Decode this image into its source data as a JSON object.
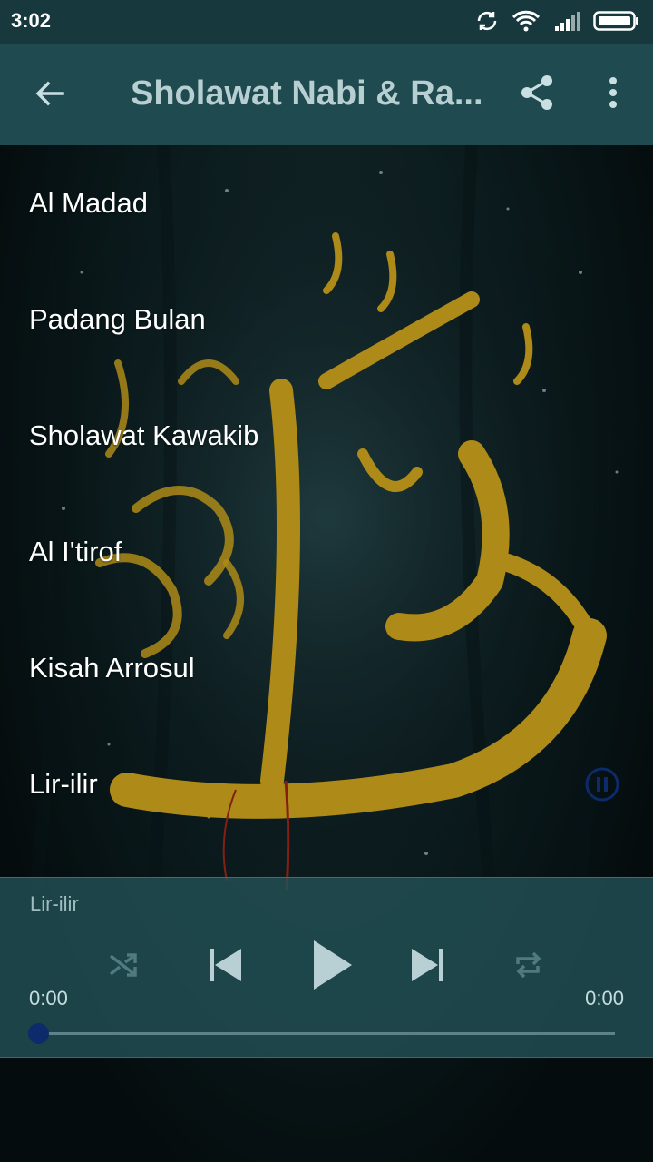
{
  "status_bar": {
    "time": "3:02",
    "icons": [
      "sync-icon",
      "wifi-icon",
      "signal-icon",
      "battery-icon"
    ]
  },
  "app_bar": {
    "title": "Sholawat Nabi & Ra...",
    "back_icon": "arrow-left-icon",
    "share_icon": "share-icon",
    "menu_icon": "more-vert-icon"
  },
  "songs": [
    {
      "title": "Al Madad"
    },
    {
      "title": "Padang Bulan"
    },
    {
      "title": "Sholawat Kawakib"
    },
    {
      "title": "Al I'tirof"
    },
    {
      "title": "Kisah Arrosul"
    },
    {
      "title": "Lir-ilir"
    }
  ],
  "player": {
    "now_playing": "Lir-ilir",
    "time_current": "0:00",
    "time_total": "0:00",
    "progress": 0,
    "controls": [
      "shuffle-icon",
      "skip-previous-icon",
      "play-icon",
      "skip-next-icon",
      "repeat-icon"
    ]
  },
  "colors": {
    "app_bar": "#1f4a50",
    "status_bar": "#17393e",
    "accent": "#0d2a6b",
    "calligraphy": "#e8b820"
  }
}
